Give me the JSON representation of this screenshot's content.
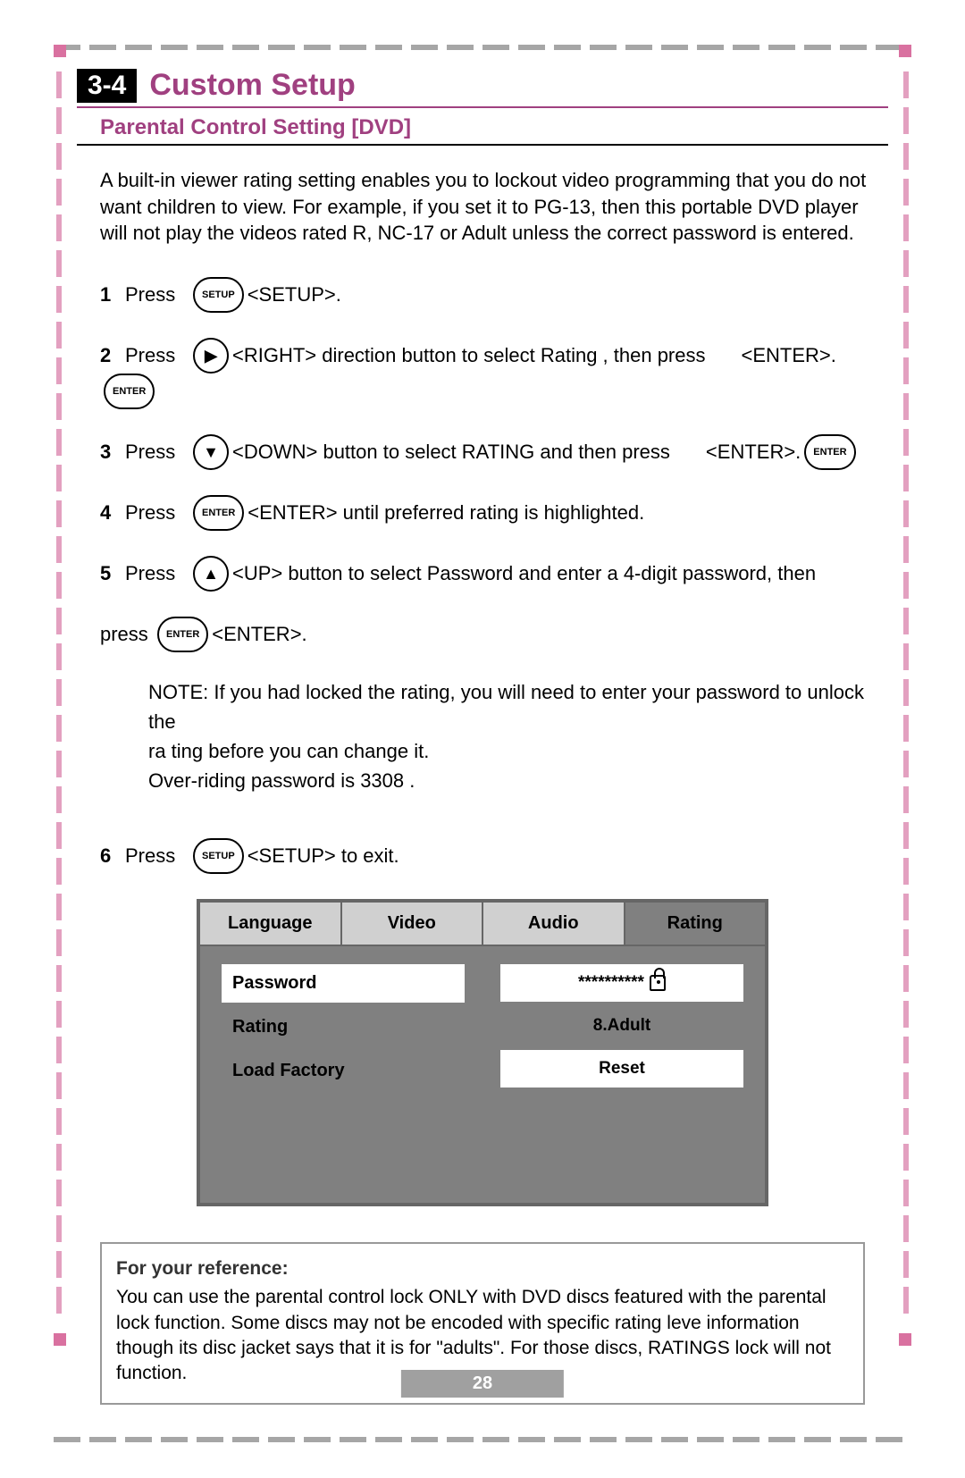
{
  "section_badge": "3-4",
  "section_title": "Custom Setup",
  "subsection": "Parental Control Setting [DVD]",
  "intro": "A built-in viewer rating setting enables you to lockout video programming that you do not want children to view. For example, if you set it to PG-13, then this portable DVD player will not play the videos rated R, NC-17 or Adult unless the correct password is entered.",
  "steps": {
    "press_label": "Press",
    "press_lower": "press",
    "s1": {
      "num": "1",
      "btn": "SETUP",
      "after": "<SETUP>."
    },
    "s2": {
      "num": "2",
      "arrow": "▶",
      "txt1": "<RIGHT> direction button to select  Rating ,   then press",
      "enter_lbl": "<ENTER>.",
      "enter_btn": "ENTER"
    },
    "s3": {
      "num": "3",
      "arrow": "▼",
      "txt1": "<DOWN> button to select  RATING  and then press",
      "enter_lbl": "<ENTER>.",
      "enter_btn": "ENTER"
    },
    "s4": {
      "num": "4",
      "btn": "ENTER",
      "txt": "<ENTER> until preferred rating is highlighted."
    },
    "s5": {
      "num": "5",
      "arrow": "▲",
      "txt": "<UP> button to select Password and enter a 4-digit password, then"
    },
    "s5b": {
      "btn": "ENTER",
      "after": "<ENTER>."
    },
    "s6": {
      "num": "6",
      "btn": "SETUP",
      "txt": "<SETUP> to exit."
    }
  },
  "note": {
    "l1": "NOTE: If you had locked the rating, you will need to enter your password to unlock the",
    "l2": "ra ting before you can change it.",
    "l3": "Over-riding password is  3308 ."
  },
  "menu": {
    "tabs": {
      "language": "Language",
      "video": "Video",
      "audio": "Audio",
      "rating": "Rating"
    },
    "items": {
      "password": "Password",
      "rating": "Rating",
      "load_factory": "Load Factory"
    },
    "values": {
      "password_mask": "**********",
      "rating_val": "8.Adult",
      "reset": "Reset"
    }
  },
  "reference": {
    "title": "For your reference:",
    "body": "You can use the parental control lock ONLY with DVD discs featured with the parental lock function. Some discs may not be encoded with specific rating leve information though its disc jacket says that it is for \"adults\". For those discs, RATINGS lock will not function."
  },
  "page_number": "28"
}
